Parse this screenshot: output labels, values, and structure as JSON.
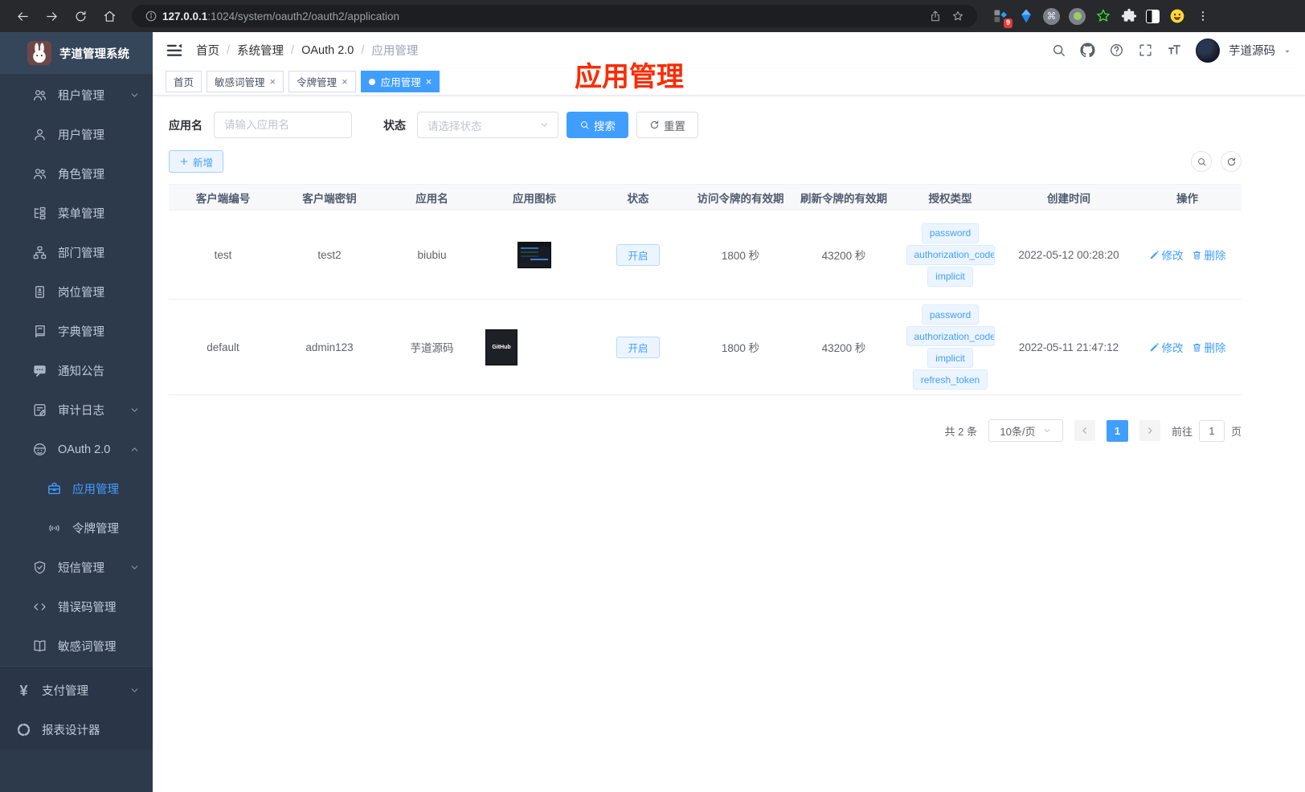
{
  "browser": {
    "url_host": "127.0.0.1",
    "url_rest": ":1024/system/oauth2/oauth2/application",
    "extension_badge": "9"
  },
  "sidebar": {
    "app_title": "芋道管理系统",
    "items": [
      {
        "label": "租户管理",
        "icon": "users",
        "arrow": "down"
      },
      {
        "label": "用户管理",
        "icon": "user"
      },
      {
        "label": "角色管理",
        "icon": "users"
      },
      {
        "label": "菜单管理",
        "icon": "menu-tree"
      },
      {
        "label": "部门管理",
        "icon": "org-chart"
      },
      {
        "label": "岗位管理",
        "icon": "id-badge"
      },
      {
        "label": "字典管理",
        "icon": "dictionary"
      },
      {
        "label": "通知公告",
        "icon": "announcement"
      },
      {
        "label": "审计日志",
        "icon": "audit-log",
        "arrow": "down"
      },
      {
        "label": "OAuth 2.0",
        "icon": "robot",
        "arrow": "up"
      },
      {
        "label": "应用管理",
        "icon": "briefcase",
        "active": true
      },
      {
        "label": "令牌管理",
        "icon": "token-signal"
      },
      {
        "label": "短信管理",
        "icon": "shield-check",
        "arrow": "down"
      },
      {
        "label": "错误码管理",
        "icon": "code"
      },
      {
        "label": "敏感词管理",
        "icon": "open-book"
      },
      {
        "label": "支付管理",
        "icon": "yen",
        "arrow": "down"
      },
      {
        "label": "报表设计器",
        "icon": "pie-circle"
      }
    ]
  },
  "navbar": {
    "breadcrumb": [
      "首页",
      "系统管理",
      "OAuth 2.0",
      "应用管理"
    ],
    "username": "芋道源码"
  },
  "tabs": [
    {
      "label": "首页"
    },
    {
      "label": "敏感词管理",
      "closable": true
    },
    {
      "label": "令牌管理",
      "closable": true
    },
    {
      "label": "应用管理",
      "closable": true,
      "active": true
    }
  ],
  "annotation": {
    "text": "应用管理",
    "color": "#fb2b00"
  },
  "filters": {
    "app_name_label": "应用名",
    "app_name_placeholder": "请输入应用名",
    "status_label": "状态",
    "status_placeholder": "请选择状态",
    "search_button": "搜索",
    "reset_button": "重置",
    "add_button": "新增"
  },
  "table": {
    "headers": [
      "客户端编号",
      "客户端密钥",
      "应用名",
      "应用图标",
      "状态",
      "访问令牌的有效期",
      "刷新令牌的有效期",
      "授权类型",
      "创建时间",
      "操作"
    ],
    "rows": [
      {
        "client_id": "test",
        "secret": "test2",
        "app_name": "biubiu",
        "status": "开启",
        "access_ttl": "1800 秒",
        "refresh_ttl": "43200 秒",
        "grant_types": [
          "password",
          "authorization_code",
          "implicit"
        ],
        "created_at": "2022-05-12 00:28:20",
        "edit": "修改",
        "delete": "删除"
      },
      {
        "client_id": "default",
        "secret": "admin123",
        "app_name": "芋道源码",
        "status": "开启",
        "access_ttl": "1800 秒",
        "refresh_ttl": "43200 秒",
        "grant_types": [
          "password",
          "authorization_code",
          "implicit",
          "refresh_token"
        ],
        "created_at": "2022-05-11 21:47:12",
        "edit": "修改",
        "delete": "删除",
        "icon_label": "GitHub"
      }
    ]
  },
  "pagination": {
    "total": "共 2 条",
    "page_size": "10条/页",
    "current_page": "1",
    "goto_label": "前往",
    "goto_value": "1",
    "page_unit": "页"
  },
  "colors": {
    "accent": "#409eff",
    "sidebar_bg": "#2d3a4c",
    "tag_bg": "#ecf5ff"
  }
}
